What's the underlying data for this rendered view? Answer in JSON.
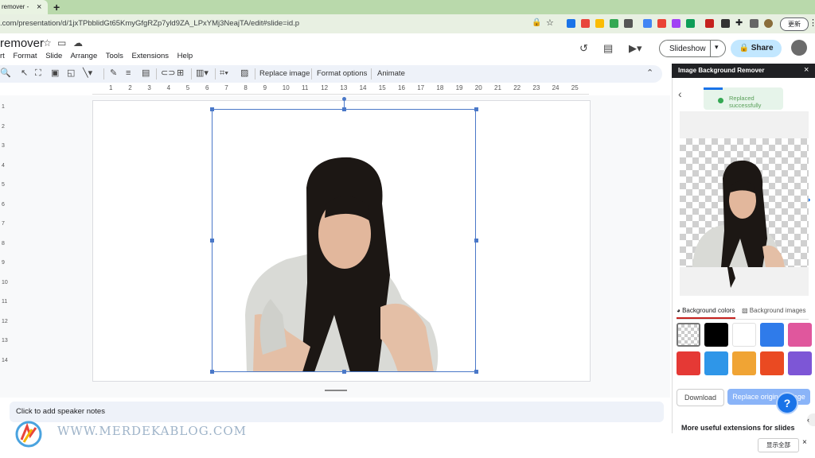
{
  "browser": {
    "tab_title": "remover - ",
    "tab_close": "×",
    "new_tab": "+",
    "url": ".com/presentation/d/1jxTPbblidGt65KmyGfgRZp7yld9ZA_LPxYMj3NeajTA/edit#slide=id.p",
    "update_label": "更新"
  },
  "doc": {
    "title": "remover",
    "menu": [
      "rt",
      "Format",
      "Slide",
      "Arrange",
      "Tools",
      "Extensions",
      "Help"
    ],
    "slideshow_label": "Slideshow",
    "share_label": "Share"
  },
  "toolbar": {
    "replace_image": "Replace image",
    "format_options": "Format options",
    "animate": "Animate"
  },
  "ruler": {
    "h_numbers": [
      "1",
      "2",
      "3",
      "4",
      "5",
      "6",
      "7",
      "8",
      "9",
      "10",
      "11",
      "12",
      "13",
      "14",
      "15",
      "16",
      "17",
      "18",
      "19",
      "20",
      "21",
      "22",
      "23",
      "24",
      "25"
    ],
    "v_numbers": [
      "1",
      "2",
      "3",
      "4",
      "5",
      "6",
      "7",
      "8",
      "9",
      "10",
      "11",
      "12",
      "13",
      "14"
    ]
  },
  "notes": {
    "placeholder": "Click to add speaker notes"
  },
  "panel": {
    "title": "Image Background Remover",
    "close": "×",
    "toast": "Replaced successfully",
    "tab_colors": "Background colors",
    "tab_images": "Background images",
    "swatches": [
      "transparent",
      "#000000",
      "#ffffff",
      "#2f7bea",
      "#e0579d",
      "#e53935",
      "#2f96e8",
      "#f0a434",
      "#ea4a22",
      "#7d56d6"
    ],
    "download": "Download",
    "replace": "Replace original image",
    "help": "?",
    "more": "More useful extensions for slides"
  },
  "footer": {
    "watermark": "WWW.MERDEKABLOG.COM",
    "show_all": "显示全部",
    "close": "×"
  },
  "icons": [
    "star-icon",
    "folder-icon",
    "cloud-icon",
    "history-icon",
    "comment-icon",
    "video-icon",
    "search-icon",
    "cursor-icon",
    "pen-icon",
    "link-icon",
    "crop-icon",
    "back-arrow-icon",
    "help-icon"
  ]
}
